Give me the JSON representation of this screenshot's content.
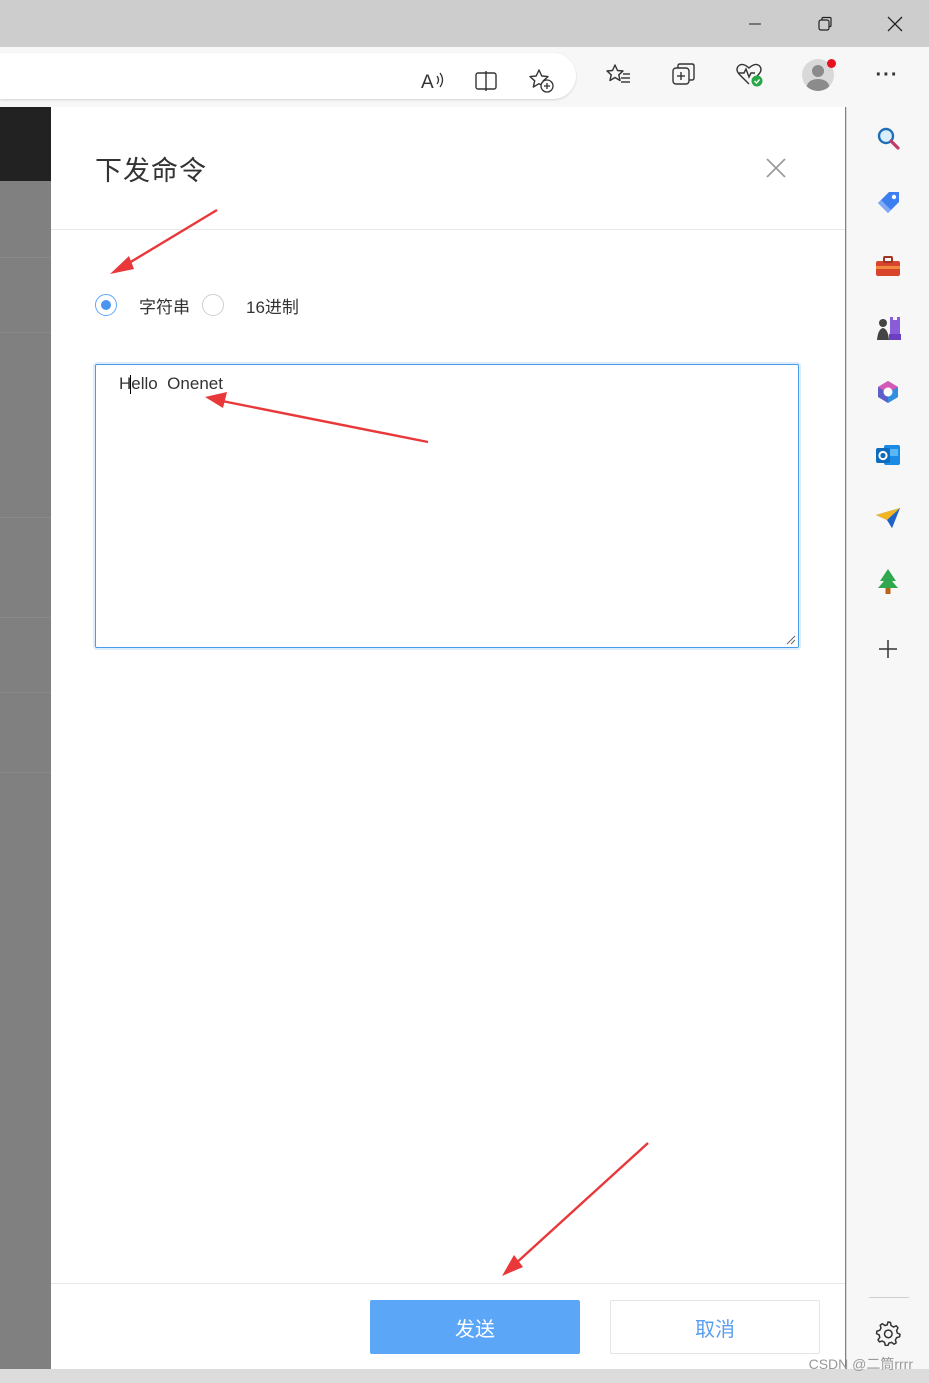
{
  "window_controls": {
    "minimize_icon": "minimize-icon",
    "restore_icon": "restore-icon",
    "close_icon": "close-icon"
  },
  "toolbar": {
    "icons": [
      "read-aloud-icon",
      "split-screen-icon",
      "add-favorite-icon",
      "favorites-icon",
      "collections-icon",
      "browser-essentials-icon",
      "profile-avatar",
      "more-menu-icon"
    ],
    "more_label": "···"
  },
  "dialog": {
    "title": "下发命令",
    "format_options": [
      {
        "label": "字符串",
        "checked": true
      },
      {
        "label": "16进制",
        "checked": false
      }
    ],
    "command_text": "Hello  Onenet",
    "send_label": "发送",
    "cancel_label": "取消"
  },
  "sidebar": {
    "icons": [
      "search-icon",
      "shopping-tag-icon",
      "tools-icon",
      "games-icon",
      "microsoft-365-icon",
      "outlook-icon",
      "send-icon",
      "tree-icon",
      "add-icon",
      "settings-icon"
    ]
  },
  "colors": {
    "accent": "#5ca6f8",
    "arrow": "#e8383a",
    "overlay": "#808080"
  },
  "watermark": "CSDN @二筒rrrr"
}
